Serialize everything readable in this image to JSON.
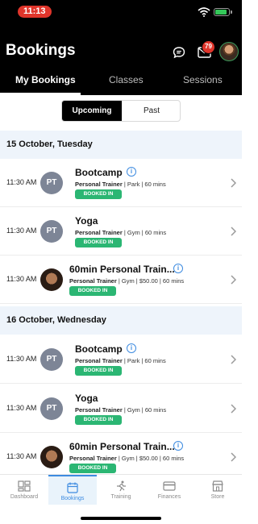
{
  "status_bar": {
    "time": "11:13"
  },
  "header": {
    "title": "Bookings",
    "notification_count": "79",
    "tabs": [
      {
        "label": "My Bookings",
        "active": true
      },
      {
        "label": "Classes",
        "active": false
      },
      {
        "label": "Sessions",
        "active": false
      }
    ]
  },
  "segmented": {
    "upcoming": "Upcoming",
    "past": "Past",
    "selected": "Upcoming"
  },
  "sections": [
    {
      "date": "15 October, Tuesday",
      "bookings": [
        {
          "time": "11:30 AM",
          "initials": "PT",
          "name": "Bootcamp",
          "trainer": "Personal Trainer",
          "details": " | Park | 60 mins",
          "status": "BOOKED IN",
          "icon": "info-icon"
        },
        {
          "time": "11:30 AM",
          "initials": "PT",
          "name": "Yoga",
          "trainer": "Personal Trainer",
          "details": " | Gym | 60 mins",
          "status": "BOOKED IN"
        },
        {
          "time": "11:30 AM",
          "initials": "",
          "name": "60min Personal Train...",
          "trainer": "Personal Trainer",
          "details": " | Gym | $50.00 | 60 mins",
          "status": "BOOKED IN",
          "icon": "info-icon"
        }
      ]
    },
    {
      "date": "16 October, Wednesday",
      "bookings": [
        {
          "time": "11:30 AM",
          "initials": "PT",
          "name": "Bootcamp",
          "trainer": "Personal Trainer",
          "details": " | Park | 60 mins",
          "status": "BOOKED IN",
          "icon": "info-icon"
        },
        {
          "time": "11:30 AM",
          "initials": "PT",
          "name": "Yoga",
          "trainer": "Personal Trainer",
          "details": " | Gym | 60 mins",
          "status": "BOOKED IN"
        },
        {
          "time": "11:30 AM",
          "initials": "",
          "name": "60min Personal Train...",
          "trainer": "Personal Trainer",
          "details": " | Gym | $50.00 | 60 mins",
          "status": "BOOKED IN",
          "icon": "info-icon"
        }
      ]
    }
  ],
  "bottom_nav": [
    {
      "label": "Dashboard",
      "icon": "dashboard-icon",
      "active": false
    },
    {
      "label": "Bookings",
      "icon": "calendar-icon",
      "active": true
    },
    {
      "label": "Training",
      "icon": "running-icon",
      "active": false
    },
    {
      "label": "Finances",
      "icon": "card-icon",
      "active": false
    },
    {
      "label": "Store",
      "icon": "store-icon",
      "active": false
    }
  ],
  "colors": {
    "accent": "#3d8be0",
    "booked": "#2bb673",
    "badge": "#e0352b",
    "avatar_bg": "#7d8596",
    "date_bg": "#eef4fb"
  }
}
